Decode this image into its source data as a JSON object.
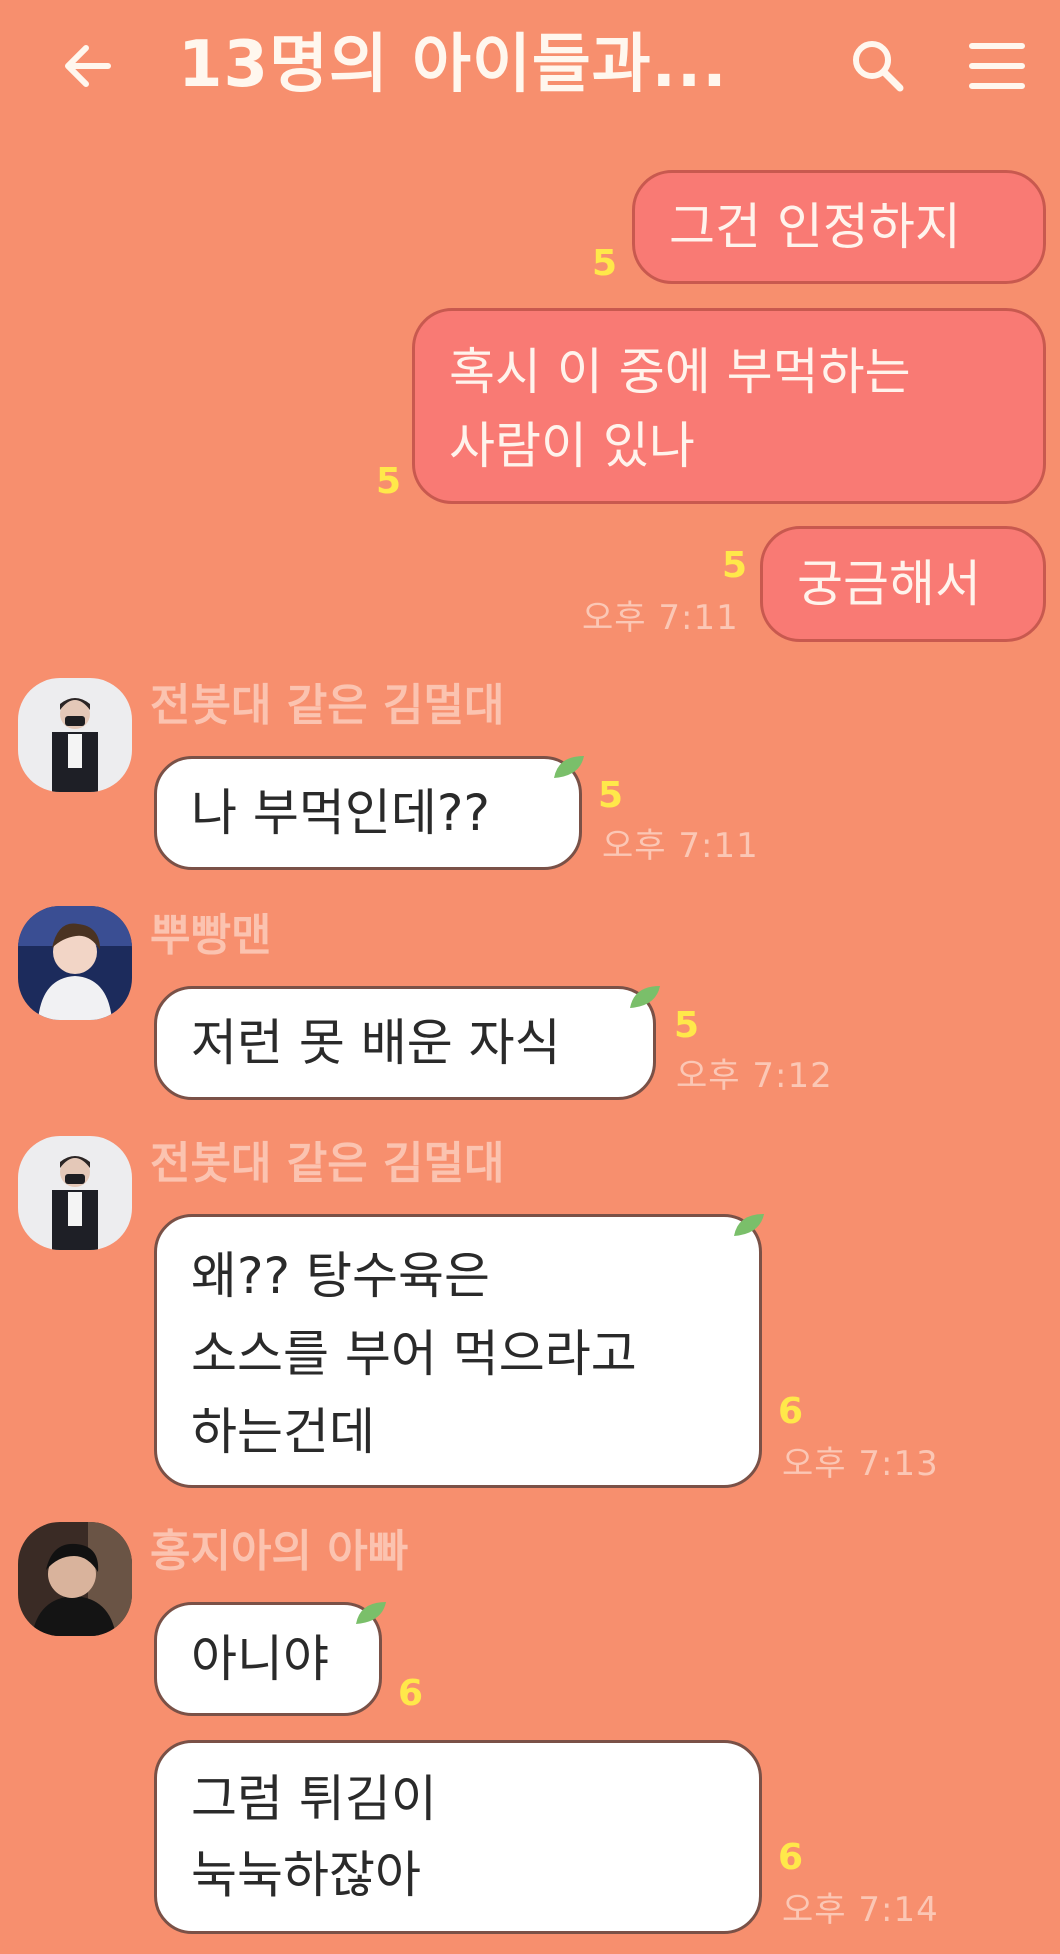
{
  "header": {
    "title": "13명의 아이들과...",
    "back_icon": "back-arrow-icon",
    "search_icon": "search-icon",
    "menu_icon": "hamburger-menu-icon"
  },
  "colors": {
    "background": "#F78F6E",
    "my_bubble": "#F97A74",
    "other_bubble": "#FFFFFF",
    "unread": "#FFE84A",
    "meta_text": "#FBC7B5"
  },
  "messages": {
    "m1": {
      "text": "그건 인정하지",
      "unread": "5"
    },
    "m2": {
      "text": "혹시 이 중에 부먹하는\n사람이 있나",
      "unread": "5"
    },
    "m3": {
      "text": "궁금해서",
      "unread": "5",
      "time": "오후 7:11"
    },
    "m4": {
      "sender": "전봇대 같은 김멀대",
      "text": "나 부먹인데??",
      "unread": "5",
      "time": "오후 7:11"
    },
    "m5": {
      "sender": "뿌빵맨",
      "text": "저런 못 배운 자식",
      "unread": "5",
      "time": "오후 7:12"
    },
    "m6": {
      "sender": "전봇대 같은 김멀대",
      "text": "왜?? 탕수육은\n소스를 부어 먹으라고\n하는건데",
      "unread": "6",
      "time": "오후 7:13"
    },
    "m7": {
      "sender": "홍지아의 아빠",
      "text": "아니야",
      "unread": "6"
    },
    "m8": {
      "text": "그럼 튀김이\n눅눅하잖아",
      "unread": "6",
      "time": "오후 7:14"
    }
  }
}
